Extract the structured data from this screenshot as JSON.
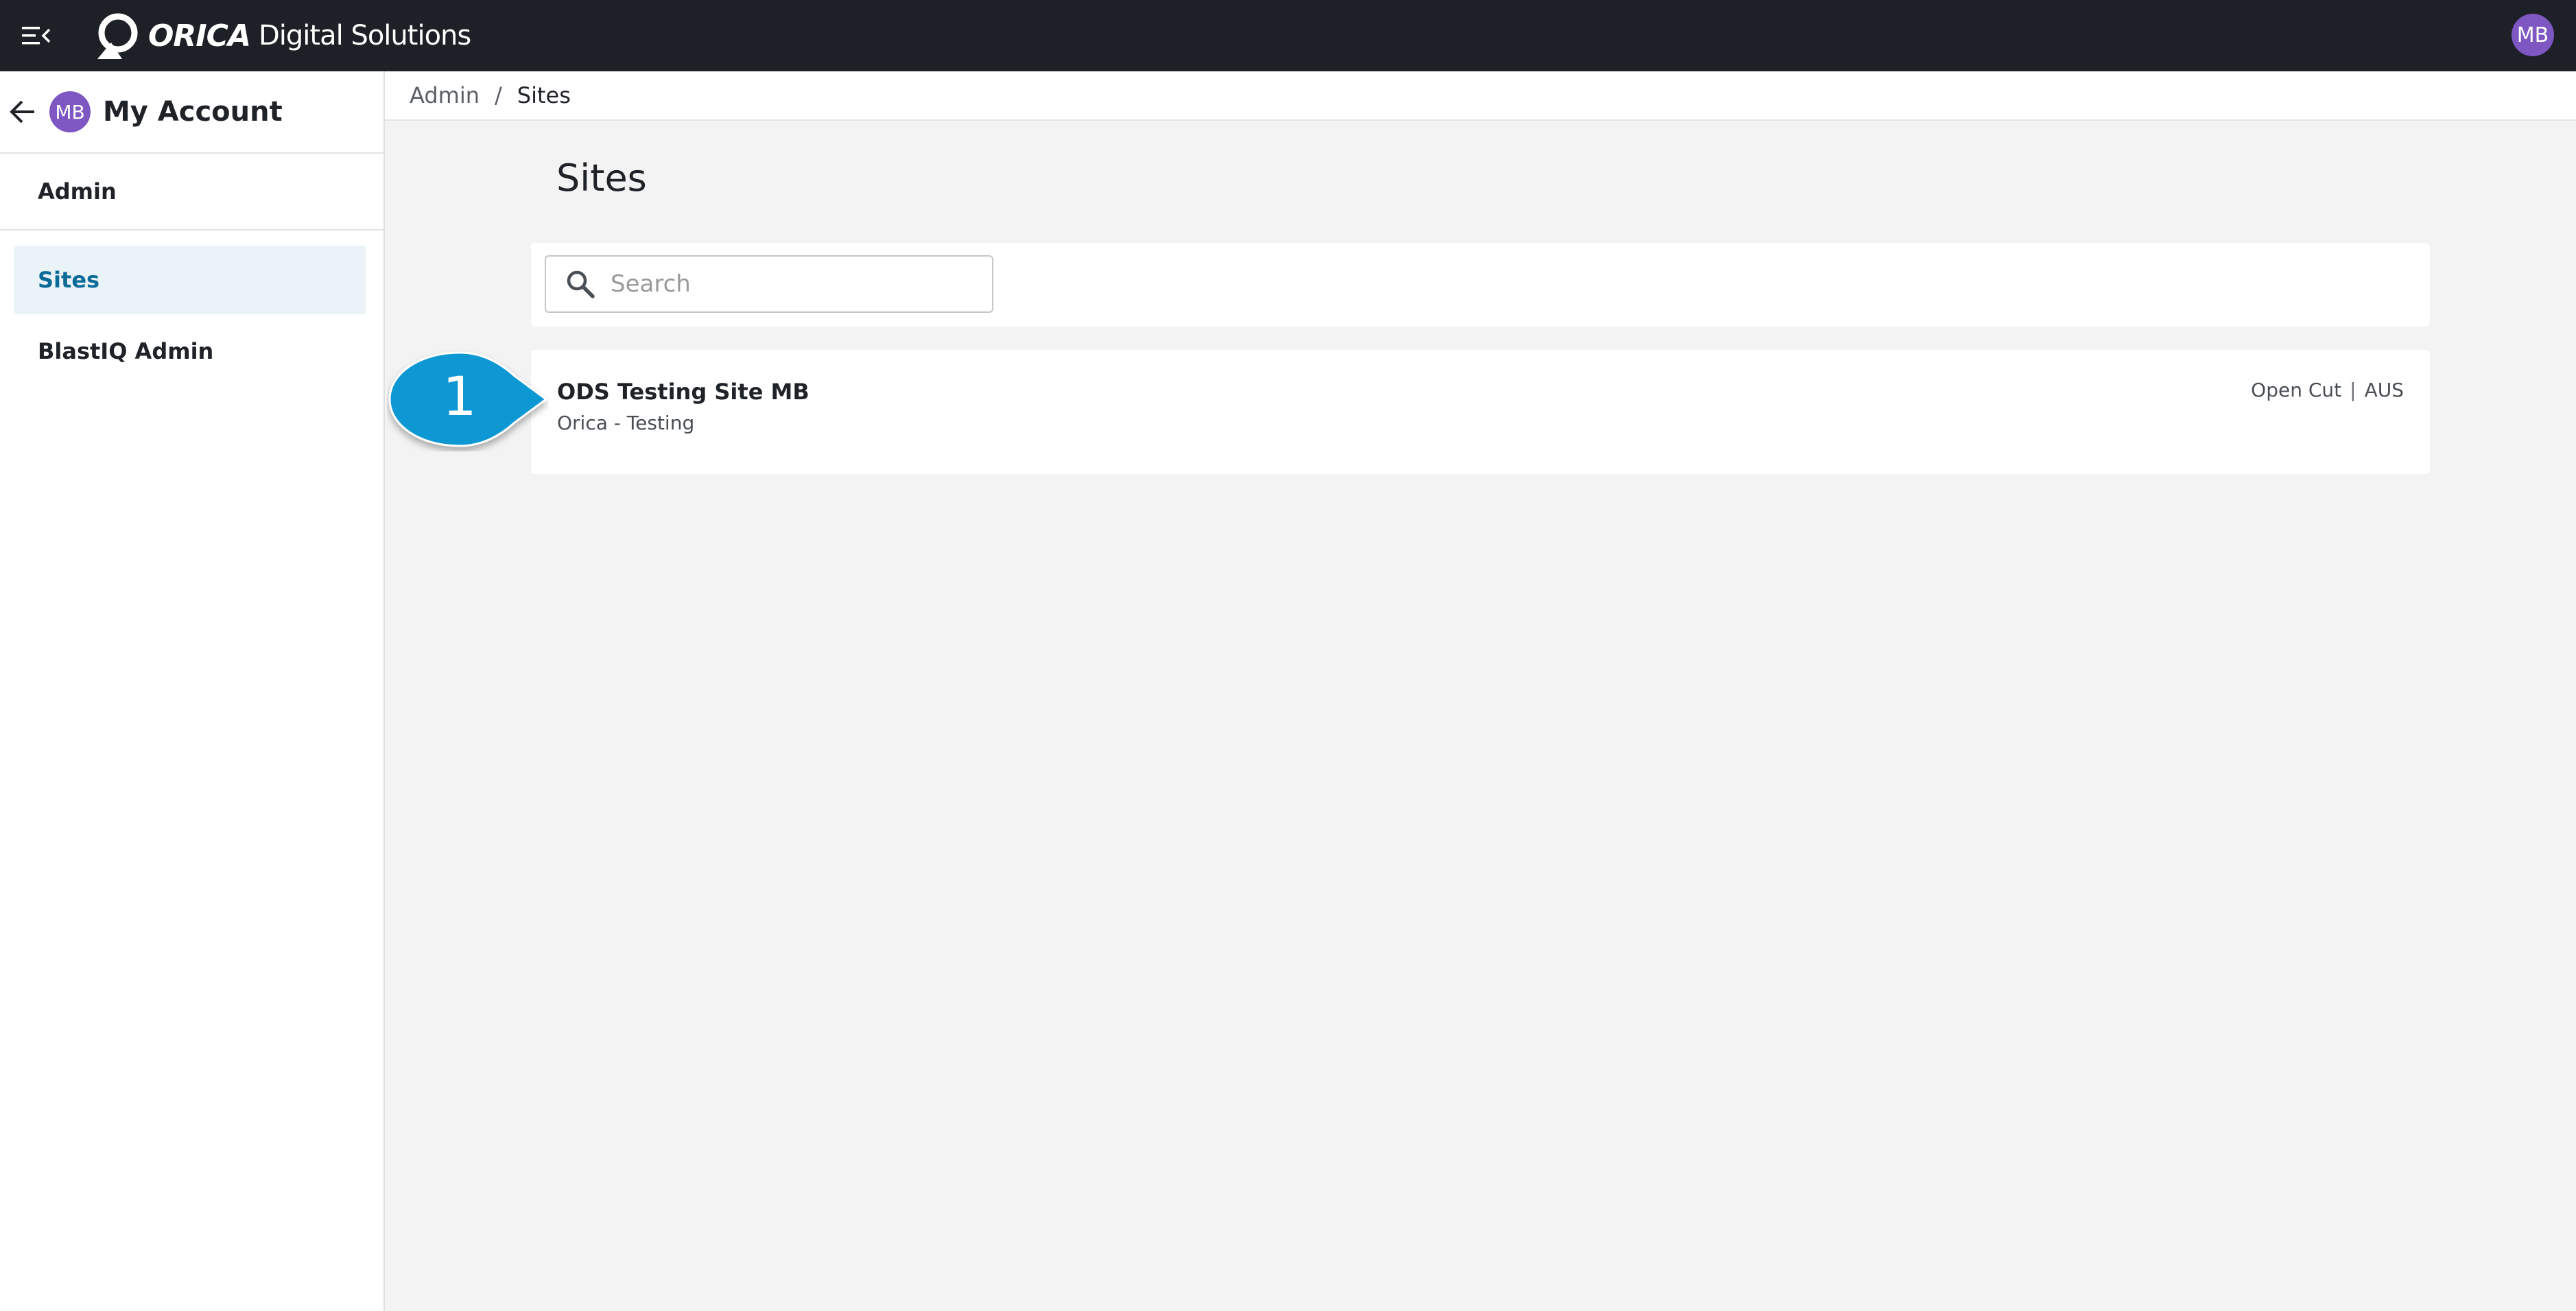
{
  "app": {
    "brand": "ORICA",
    "product": "Digital Solutions",
    "user_initials": "MB"
  },
  "sidebar": {
    "title": "My Account",
    "avatar_initials": "MB",
    "section": "Admin",
    "items": [
      {
        "label": "Sites",
        "active": true
      },
      {
        "label": "BlastIQ Admin",
        "active": false
      }
    ]
  },
  "breadcrumb": {
    "items": [
      "Admin",
      "Sites"
    ],
    "separator": "/"
  },
  "main": {
    "title": "Sites",
    "search": {
      "placeholder": "Search",
      "value": ""
    },
    "sites": [
      {
        "name": "ODS Testing Site MB",
        "org": "Orica - Testing",
        "type": "Open Cut",
        "country": "AUS"
      }
    ]
  },
  "callout": {
    "number": "1",
    "color": "#0e98d4"
  },
  "colors": {
    "topbar": "#1d2026",
    "avatar": "#7e57c2",
    "active_item_bg": "#eaf3f7",
    "active_item_text": "#0a6b99"
  }
}
